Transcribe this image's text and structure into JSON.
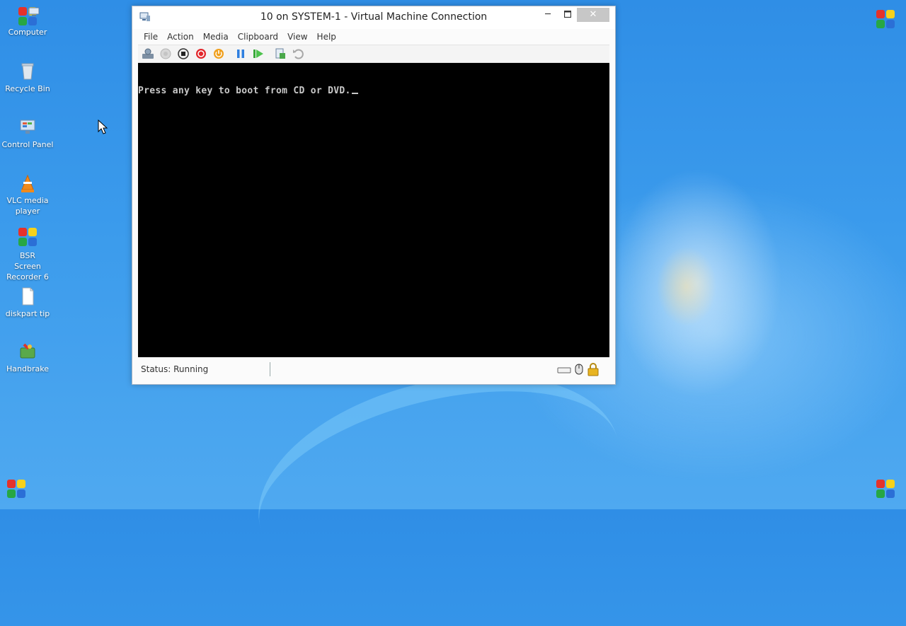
{
  "desktop": {
    "icons": [
      {
        "label": "Computer",
        "icon": "computer-icon"
      },
      {
        "label": "Recycle Bin",
        "icon": "recycle-bin-icon"
      },
      {
        "label": "Control Panel",
        "icon": "control-panel-icon"
      },
      {
        "label": "VLC media player",
        "icon": "vlc-cone-icon"
      },
      {
        "label": "BSR Screen Recorder 6",
        "icon": "bsr-recorder-icon"
      },
      {
        "label": "diskpart tip",
        "icon": "text-document-icon"
      },
      {
        "label": "Handbrake",
        "icon": "handbrake-icon"
      }
    ]
  },
  "window": {
    "title": "10 on SYSTEM-1 - Virtual Machine Connection",
    "controls": {
      "minimize": "minimize-icon",
      "maximize": "maximize-icon",
      "close": "close-icon"
    },
    "menu": [
      "File",
      "Action",
      "Media",
      "Clipboard",
      "View",
      "Help"
    ],
    "toolbar": [
      "ctrl-alt-del-icon",
      "start-icon",
      "turn-off-icon",
      "shut-down-icon",
      "save-icon",
      "pause-icon",
      "reset-icon",
      "checkpoint-icon",
      "revert-icon"
    ],
    "console": {
      "text": "Press any key to boot from CD or DVD."
    },
    "status": {
      "text": "Status: Running"
    },
    "status_icons": [
      "keyboard-icon",
      "mouse-icon",
      "lock-icon"
    ]
  },
  "colors": {
    "accent": "#2f8ee6",
    "screen": "#000000",
    "console_text": "#c8c8c8"
  }
}
